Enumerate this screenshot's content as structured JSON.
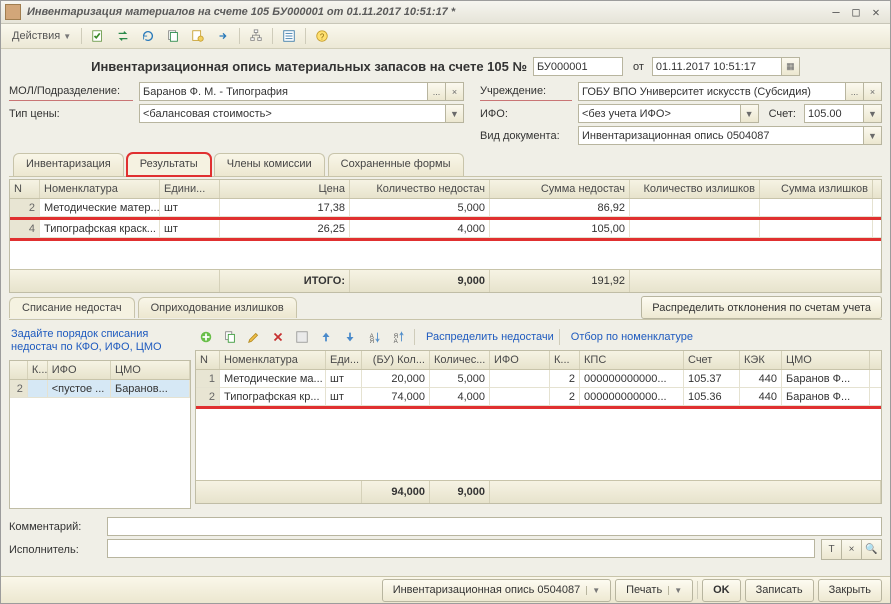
{
  "window": {
    "title": "Инвентаризация материалов на счете 105 БУ000001 от 01.11.2017 10:51:17 *"
  },
  "toolbar": {
    "actions_label": "Действия"
  },
  "doc_header": {
    "title": "Инвентаризационная опись материальных запасов на счете 105 №",
    "number": "БУ000001",
    "from_label": "от",
    "date": "01.11.2017 10:51:17"
  },
  "fields": {
    "mol_label": "МОЛ/Подразделение:",
    "mol_value": "Баранов Ф. М. - Типография",
    "price_type_label": "Тип цены:",
    "price_type_value": "<балансовая стоимость>",
    "org_label": "Учреждение:",
    "org_value": "ГОБУ ВПО Университет искусств (Субсидия)",
    "ifo_label": "ИФО:",
    "ifo_value": "<без учета ИФО>",
    "account_label": "Счет:",
    "account_value": "105.00",
    "doc_type_label": "Вид документа:",
    "doc_type_value": "Инвентаризационная опись 0504087"
  },
  "tabs": {
    "inventory": "Инвентаризация",
    "results": "Результаты",
    "commission": "Члены комиссии",
    "saved_forms": "Сохраненные формы"
  },
  "grid1": {
    "headers": {
      "n": "N",
      "nom": "Номенклатура",
      "ed": "Едини...",
      "price": "Цена",
      "knd": "Количество недостач",
      "snd": "Сумма недостач",
      "kiz": "Количество излишков",
      "siz": "Сумма излишков"
    },
    "rows": [
      {
        "n": "2",
        "nom": "Методические матер...",
        "ed": "шт",
        "price": "17,38",
        "knd": "5,000",
        "snd": "86,92",
        "kiz": "",
        "siz": ""
      },
      {
        "n": "4",
        "nom": "Типографская краск...",
        "ed": "шт",
        "price": "26,25",
        "knd": "4,000",
        "snd": "105,00",
        "kiz": "",
        "siz": ""
      }
    ],
    "footer": {
      "label": "ИТОГО:",
      "knd": "9,000",
      "snd": "191,92"
    }
  },
  "sub": {
    "tab_writeoff": "Списание недостач",
    "tab_surplus": "Оприходование излишков",
    "distribute_btn": "Распределить отклонения по счетам учета",
    "hint": "Задайте порядок списания недостач по КФО, ИФО, ЦМО",
    "toolbar": {
      "distribute_short": "Распределить недостачи",
      "filter": "Отбор по номенклатуре"
    }
  },
  "grid_left": {
    "headers": {
      "k": "К...",
      "ifo": "ИФО",
      "cmo": "ЦМО"
    },
    "rows": [
      {
        "n": "2",
        "k": "",
        "ifo": "<пустое ...",
        "cmo": "Баранов..."
      }
    ]
  },
  "grid2": {
    "headers": {
      "n": "N",
      "nom": "Номенклатура",
      "ed": "Еди...",
      "bu": "(БУ) Кол...",
      "kol": "Количес...",
      "ifo": "ИФО",
      "kfo": "К...",
      "kps": "КПС",
      "sch": "Счет",
      "kek": "КЭК",
      "cmo": "ЦМО"
    },
    "rows": [
      {
        "n": "1",
        "nom": "Методические ма...",
        "ed": "шт",
        "bu": "20,000",
        "kol": "5,000",
        "ifo": "",
        "kfo": "2",
        "kps": "000000000000...",
        "sch": "105.37",
        "kek": "440",
        "cmo": "Баранов Ф..."
      },
      {
        "n": "2",
        "nom": "Типографская кр...",
        "ed": "шт",
        "bu": "74,000",
        "kol": "4,000",
        "ifo": "",
        "kfo": "2",
        "kps": "000000000000...",
        "sch": "105.36",
        "kek": "440",
        "cmo": "Баранов Ф..."
      }
    ],
    "footer": {
      "bu": "94,000",
      "kol": "9,000"
    }
  },
  "bottom": {
    "comment_label": "Комментарий:",
    "executor_label": "Исполнитель:"
  },
  "status": {
    "form_name": "Инвентаризационная опись 0504087",
    "print": "Печать",
    "ok": "OK",
    "save": "Записать",
    "close": "Закрыть"
  },
  "chart_data": {
    "type": "table",
    "title": "Результаты инвентаризации",
    "columns": [
      "N",
      "Номенклатура",
      "Единица",
      "Цена",
      "Количество недостач",
      "Сумма недостач",
      "Количество излишков",
      "Сумма излишков"
    ],
    "rows": [
      [
        2,
        "Методические материалы",
        "шт",
        17.38,
        5.0,
        86.92,
        null,
        null
      ],
      [
        4,
        "Типографская краска",
        "шт",
        26.25,
        4.0,
        105.0,
        null,
        null
      ]
    ],
    "totals": {
      "Количество недостач": 9.0,
      "Сумма недостач": 191.92
    }
  }
}
